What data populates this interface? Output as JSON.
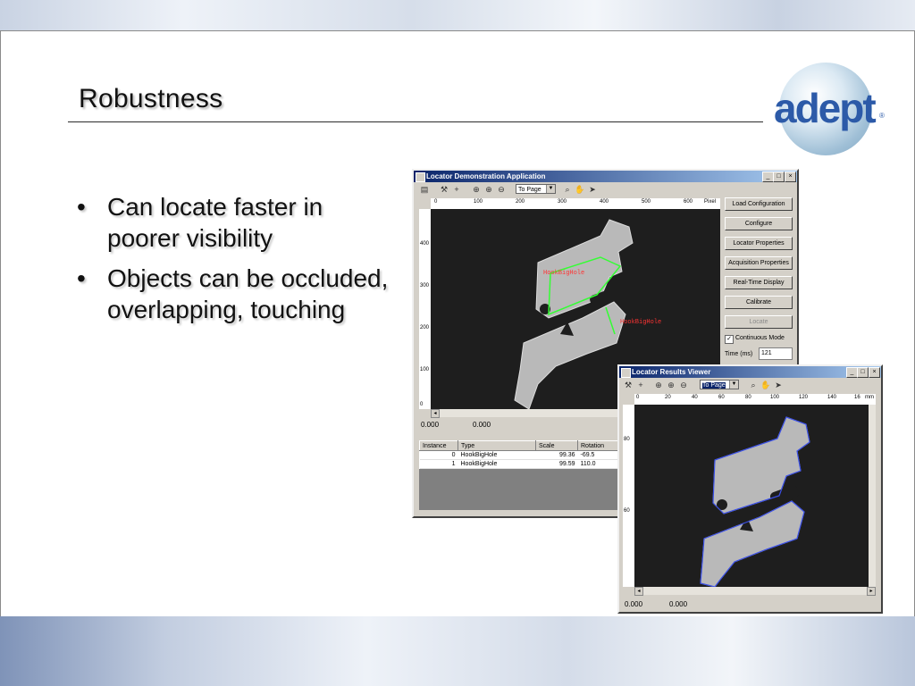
{
  "slide": {
    "title": "Robustness",
    "logo_text": "adept",
    "logo_tm": "®",
    "bullets": [
      "Can locate faster in poorer visibility",
      "Objects can be occluded, overlapping, touching"
    ],
    "bullet_glyph": "•"
  },
  "main_window": {
    "title": "Locator Demonstration Application",
    "zoom": "To Page",
    "ruler_x_ticks": [
      "0",
      "100",
      "200",
      "300",
      "400",
      "500",
      "600"
    ],
    "ruler_unit": "Pixel",
    "ruler_y_ticks": [
      "400",
      "300",
      "200",
      "100",
      "0"
    ],
    "buttons": [
      {
        "label": "Load Configuration",
        "enabled": true
      },
      {
        "label": "Configure",
        "enabled": true
      },
      {
        "label": "Locator Properties",
        "enabled": true
      },
      {
        "label": "Acquisition Properties",
        "enabled": true
      },
      {
        "label": "Real-Time Display",
        "enabled": true
      },
      {
        "label": "Calibrate",
        "enabled": true
      },
      {
        "label": "Locate",
        "enabled": false
      }
    ],
    "continuous_mode_label": "Continuous Mode",
    "continuous_mode_checked": true,
    "time_label": "Time (ms)",
    "time_value": "121",
    "status_x": "0.000",
    "status_y": "0.000",
    "label_a": "HookBigHole",
    "label_b": "HookBigHole",
    "results_columns": [
      "Instance",
      "Type",
      "Scale",
      "Rotation"
    ],
    "results_rows": [
      {
        "instance": "0",
        "type": "HookBigHole",
        "scale": "99.36",
        "rotation": "-69.5"
      },
      {
        "instance": "1",
        "type": "HookBigHole",
        "scale": "99.59",
        "rotation": "110.0"
      }
    ]
  },
  "viewer_window": {
    "title": "Locator Results Viewer",
    "zoom": "To Page",
    "ruler_x_ticks": [
      "0",
      "20",
      "40",
      "60",
      "80",
      "100",
      "120",
      "140",
      "16"
    ],
    "ruler_unit": "mm",
    "ruler_y_ticks": [
      "80",
      "60"
    ],
    "status_x": "0.000",
    "status_y": "0.000"
  },
  "colors": {
    "title_bar_start": "#0a246a",
    "title_bar_end": "#a6caf0",
    "logo": "#2c5aa8",
    "match_outline": "#33ff33",
    "viewer_outline": "#3a4fe8",
    "match_label": "#ff3333"
  }
}
